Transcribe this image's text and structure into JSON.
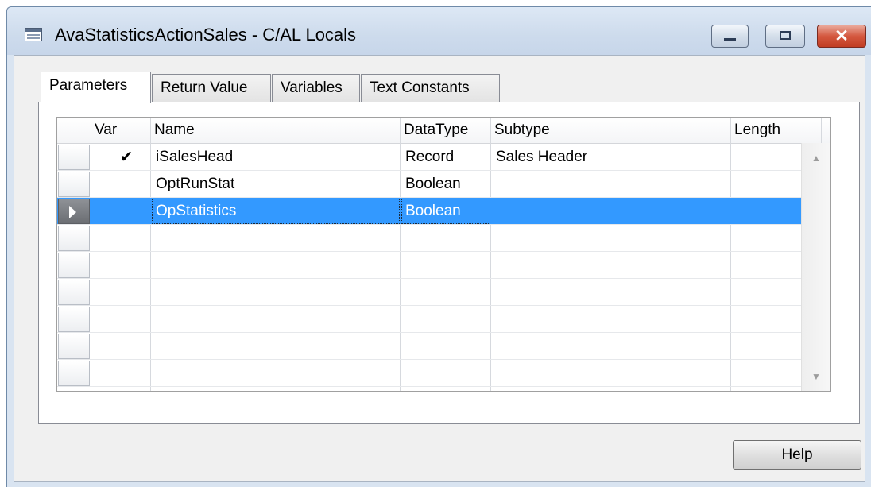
{
  "window": {
    "title": "AvaStatisticsActionSales - C/AL Locals",
    "icon": "table-window-icon",
    "controls": {
      "minimize_icon": "minimize-icon",
      "maximize_icon": "maximize-icon",
      "close_icon": "close-icon",
      "close_glyph": "✕"
    }
  },
  "tabs": [
    {
      "label": "Parameters",
      "active": true
    },
    {
      "label": "Return Value",
      "active": false
    },
    {
      "label": "Variables",
      "active": false
    },
    {
      "label": "Text Constants",
      "active": false
    }
  ],
  "grid": {
    "columns": [
      "Var",
      "Name",
      "DataType",
      "Subtype",
      "Length"
    ],
    "rows": [
      {
        "var": "✔",
        "name": "iSalesHead",
        "datatype": "Record",
        "subtype": "Sales Header",
        "length": ""
      },
      {
        "var": "",
        "name": "OptRunStat",
        "datatype": "Boolean",
        "subtype": "",
        "length": ""
      },
      {
        "var": "",
        "name": "OpStatistics",
        "datatype": "Boolean",
        "subtype": "",
        "length": "",
        "selected": true
      }
    ],
    "scroll_up": "▲",
    "scroll_down": "▼",
    "selection_color": "#3399ff"
  },
  "buttons": {
    "help": "Help"
  }
}
